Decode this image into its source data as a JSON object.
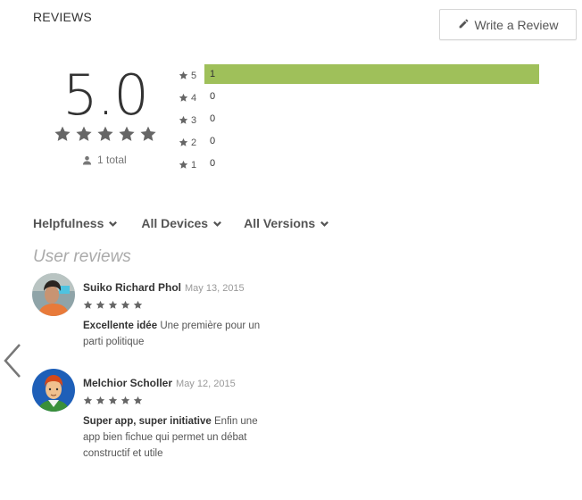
{
  "header": {
    "title": "REVIEWS",
    "write_review_label": "Write a Review"
  },
  "summary": {
    "score": "5.0",
    "stars": 5,
    "total_label": "1 total",
    "histogram": [
      {
        "rating": "5",
        "count": "1",
        "fraction": 1.0
      },
      {
        "rating": "4",
        "count": "0",
        "fraction": 0
      },
      {
        "rating": "3",
        "count": "0",
        "fraction": 0
      },
      {
        "rating": "2",
        "count": "0",
        "fraction": 0
      },
      {
        "rating": "1",
        "count": "0",
        "fraction": 0
      }
    ],
    "bar_color": "#9fc05a"
  },
  "filters": {
    "sort": "Helpfulness",
    "devices": "All Devices",
    "versions": "All Versions"
  },
  "user_reviews_title": "User reviews",
  "reviews": [
    {
      "author": "Suiko Richard Phol",
      "date": "May 13, 2015",
      "stars": 5,
      "title": "Excellente idée",
      "text": "Une première pour un parti politique"
    },
    {
      "author": "Melchior Scholler",
      "date": "May 12, 2015",
      "stars": 5,
      "title": "Super app, super initiative",
      "text": "Enfin une app bien fichue qui permet un débat constructif et utile"
    }
  ],
  "icons": {
    "star": "star-icon",
    "pencil": "pencil-icon",
    "person": "person-icon",
    "chevron": "chevron-down-icon",
    "prev": "chevron-left-icon"
  }
}
